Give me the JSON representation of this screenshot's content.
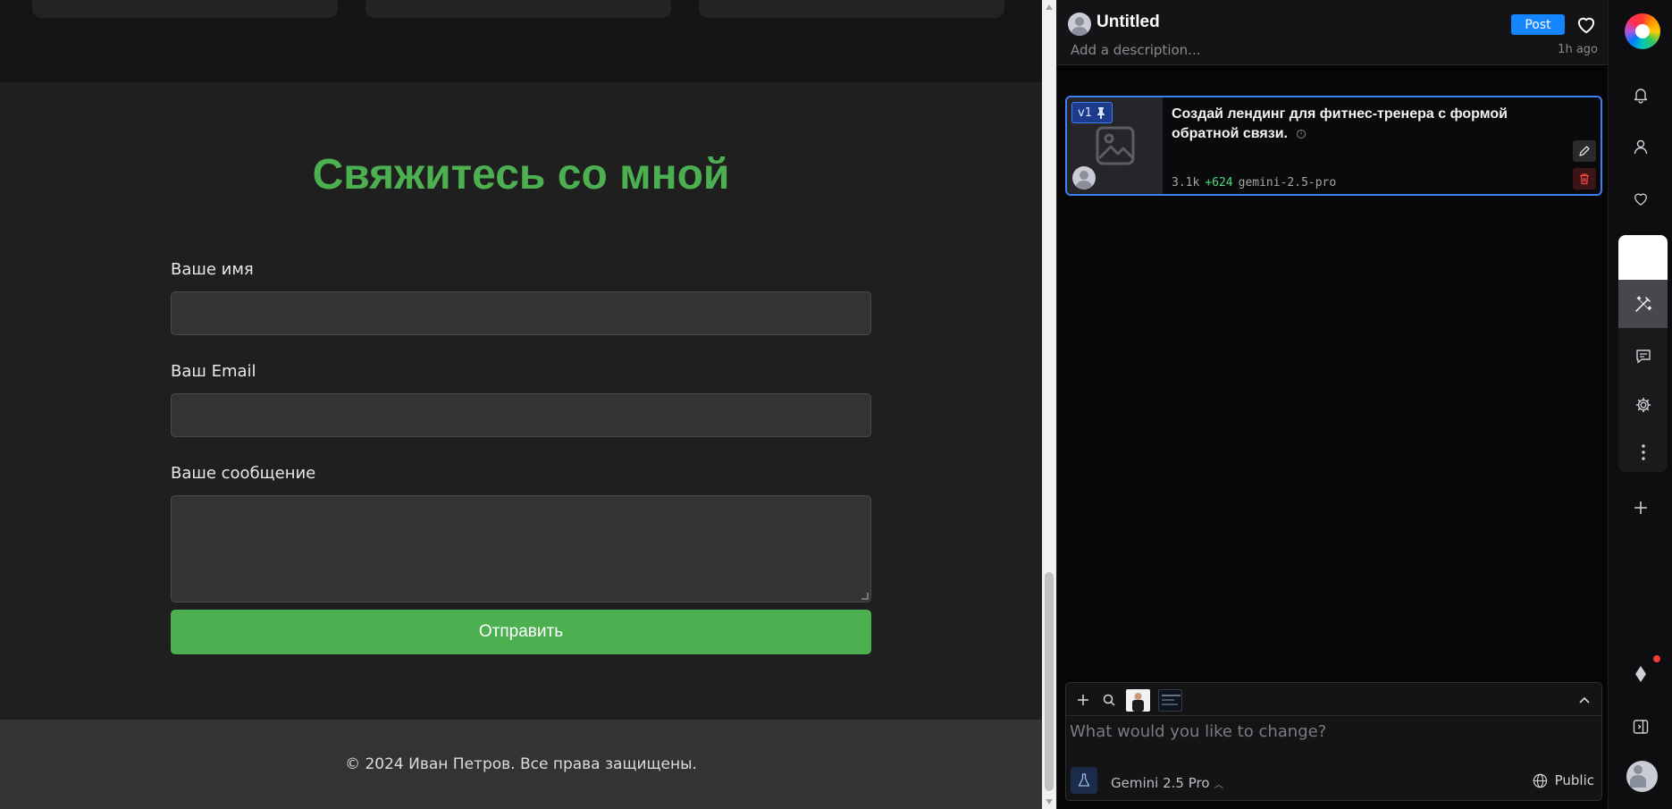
{
  "preview": {
    "contact_title": "Свяжитесь со мной",
    "form": {
      "name_label": "Ваше имя",
      "email_label": "Ваш Email",
      "message_label": "Ваше сообщение",
      "submit_label": "Отправить"
    },
    "footer_text": "© 2024 Иван Петров. Все права защищены.",
    "colors": {
      "accent": "#4caf50",
      "background": "#1f1f1f",
      "footer": "#333333"
    }
  },
  "panel": {
    "title": "Untitled",
    "description_placeholder": "Add a description...",
    "post_label": "Post",
    "updated": "1h ago",
    "version": {
      "badge": "v1",
      "prompt": "Создай лендинг для фитнес-тренера с формой обратной связи.",
      "tokens": "3.1k",
      "added": "+624",
      "model_id": "gemini-2.5-pro"
    },
    "composer": {
      "placeholder": "What would you like to change?",
      "model_label": "Gemini 2.5 Pro",
      "visibility_label": "Public"
    },
    "colors": {
      "accent": "#1485ff",
      "selection": "#3b82f6"
    }
  },
  "rail": {
    "icons": [
      "logo",
      "bell-icon",
      "user-icon",
      "heart-icon",
      "magic-wand-icon",
      "comment-icon",
      "gear-icon",
      "more-vertical-icon",
      "plus-icon",
      "diamond-icon",
      "sidebar-toggle-icon",
      "avatar"
    ]
  }
}
